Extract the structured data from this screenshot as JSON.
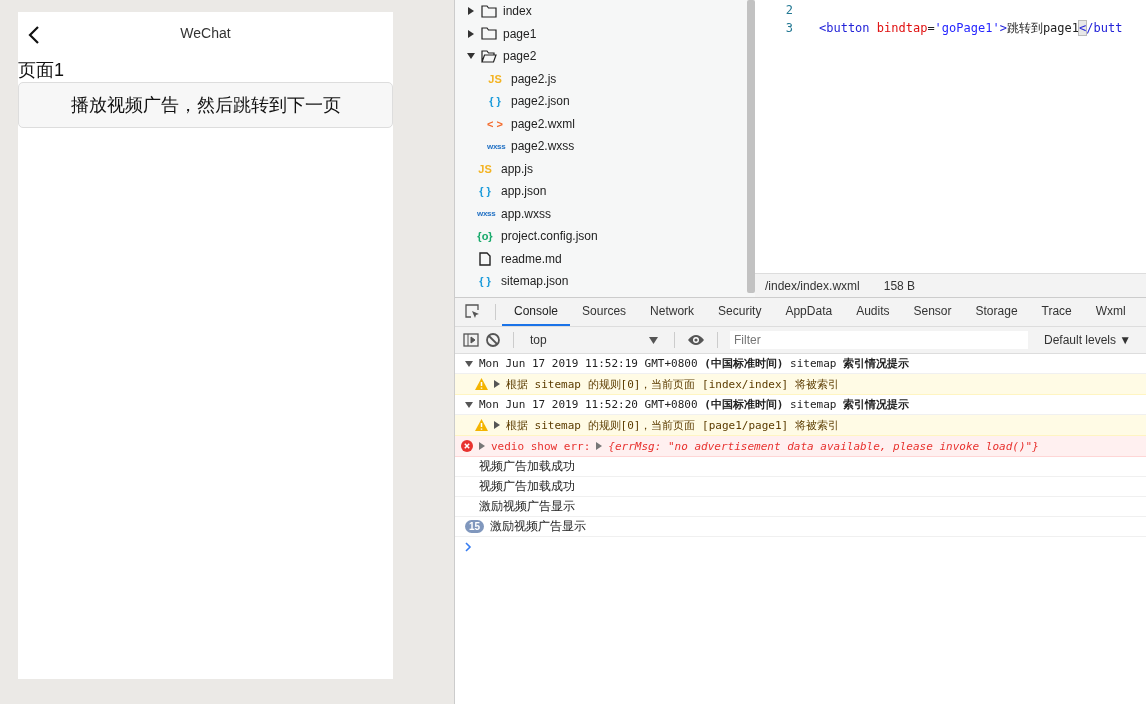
{
  "phone": {
    "nav_title": "WeChat",
    "heading": "页面1",
    "button": "播放视频广告，然后跳转到下一页"
  },
  "file_tree": [
    {
      "kind": "folder",
      "name": "index",
      "expanded": false
    },
    {
      "kind": "folder",
      "name": "page1",
      "expanded": false
    },
    {
      "kind": "folder",
      "name": "page2",
      "expanded": true,
      "children": [
        {
          "kind": "file",
          "icon": "JS",
          "color": "#f3b322",
          "name": "page2.js"
        },
        {
          "kind": "file",
          "icon": "{ }",
          "color": "#1a9bdb",
          "name": "page2.json"
        },
        {
          "kind": "file",
          "icon": "< >",
          "color": "#f36a2b",
          "name": "page2.wxml"
        },
        {
          "kind": "file",
          "icon": "wxss",
          "color": "#2573c5",
          "name": "page2.wxss"
        }
      ]
    },
    {
      "kind": "file",
      "icon": "JS",
      "color": "#f3b322",
      "name": "app.js"
    },
    {
      "kind": "file",
      "icon": "{ }",
      "color": "#1a9bdb",
      "name": "app.json"
    },
    {
      "kind": "file",
      "icon": "wxss",
      "color": "#2573c5",
      "name": "app.wxss"
    },
    {
      "kind": "file",
      "icon": "{o}",
      "color": "#16a96a",
      "name": "project.config.json"
    },
    {
      "kind": "file",
      "name": "readme.md"
    },
    {
      "kind": "file",
      "icon": "{ }",
      "color": "#1a9bdb",
      "name": "sitemap.json"
    }
  ],
  "editor": {
    "lines": [
      {
        "number": "2"
      },
      {
        "number": "3",
        "tokens": [
          {
            "kind": "tag",
            "text": "<button"
          },
          {
            "kind": "attr",
            "text": " bindtap"
          },
          {
            "kind": "plain",
            "text": "="
          },
          {
            "kind": "string",
            "text": "'goPage1'"
          },
          {
            "kind": "tag",
            "text": ">"
          },
          {
            "kind": "plain",
            "text": "跳转到page1"
          },
          {
            "kind": "cursor",
            "text": "<"
          },
          {
            "kind": "tag",
            "text": "/butt"
          }
        ]
      }
    ],
    "status_path": "/index/index.wxml",
    "status_size": "158 B"
  },
  "devtools": {
    "tabs": [
      {
        "label": "Console",
        "selected": true
      },
      {
        "label": "Sources",
        "selected": false
      },
      {
        "label": "Network",
        "selected": false
      },
      {
        "label": "Security",
        "selected": false
      },
      {
        "label": "AppData",
        "selected": false
      },
      {
        "label": "Audits",
        "selected": false
      },
      {
        "label": "Sensor",
        "selected": false
      },
      {
        "label": "Storage",
        "selected": false
      },
      {
        "label": "Trace",
        "selected": false
      },
      {
        "label": "Wxml",
        "selected": false
      }
    ],
    "context": "top",
    "filter_placeholder": "Filter",
    "levels": "Default levels ▼",
    "entries": [
      {
        "kind": "group",
        "expanded": true,
        "text": "Mon Jun 17 2019 11:52:19 GMT+0800 **(中国标准时间)** sitemap **索引情况提示**"
      },
      {
        "kind": "warning",
        "text": "根据 sitemap 的规则[0]，当前页面 [index/index] 将被索引"
      },
      {
        "kind": "group",
        "expanded": true,
        "text": "Mon Jun 17 2019 11:52:20 GMT+0800 **(中国标准时间)** sitemap **索引情况提示**"
      },
      {
        "kind": "warning",
        "text": "根据 sitemap 的规则[0]，当前页面 [page1/page1] 将被索引"
      },
      {
        "kind": "error",
        "label": "vedio show err:",
        "object": "{errMsg: \"no advertisement data available, please invoke load()\"}"
      },
      {
        "kind": "log",
        "text": "视频广告加载成功"
      },
      {
        "kind": "log",
        "text": "视频广告加载成功"
      },
      {
        "kind": "log",
        "text": "激励视频广告显示"
      },
      {
        "kind": "log",
        "count": "15",
        "text": "激励视频广告显示"
      }
    ]
  }
}
